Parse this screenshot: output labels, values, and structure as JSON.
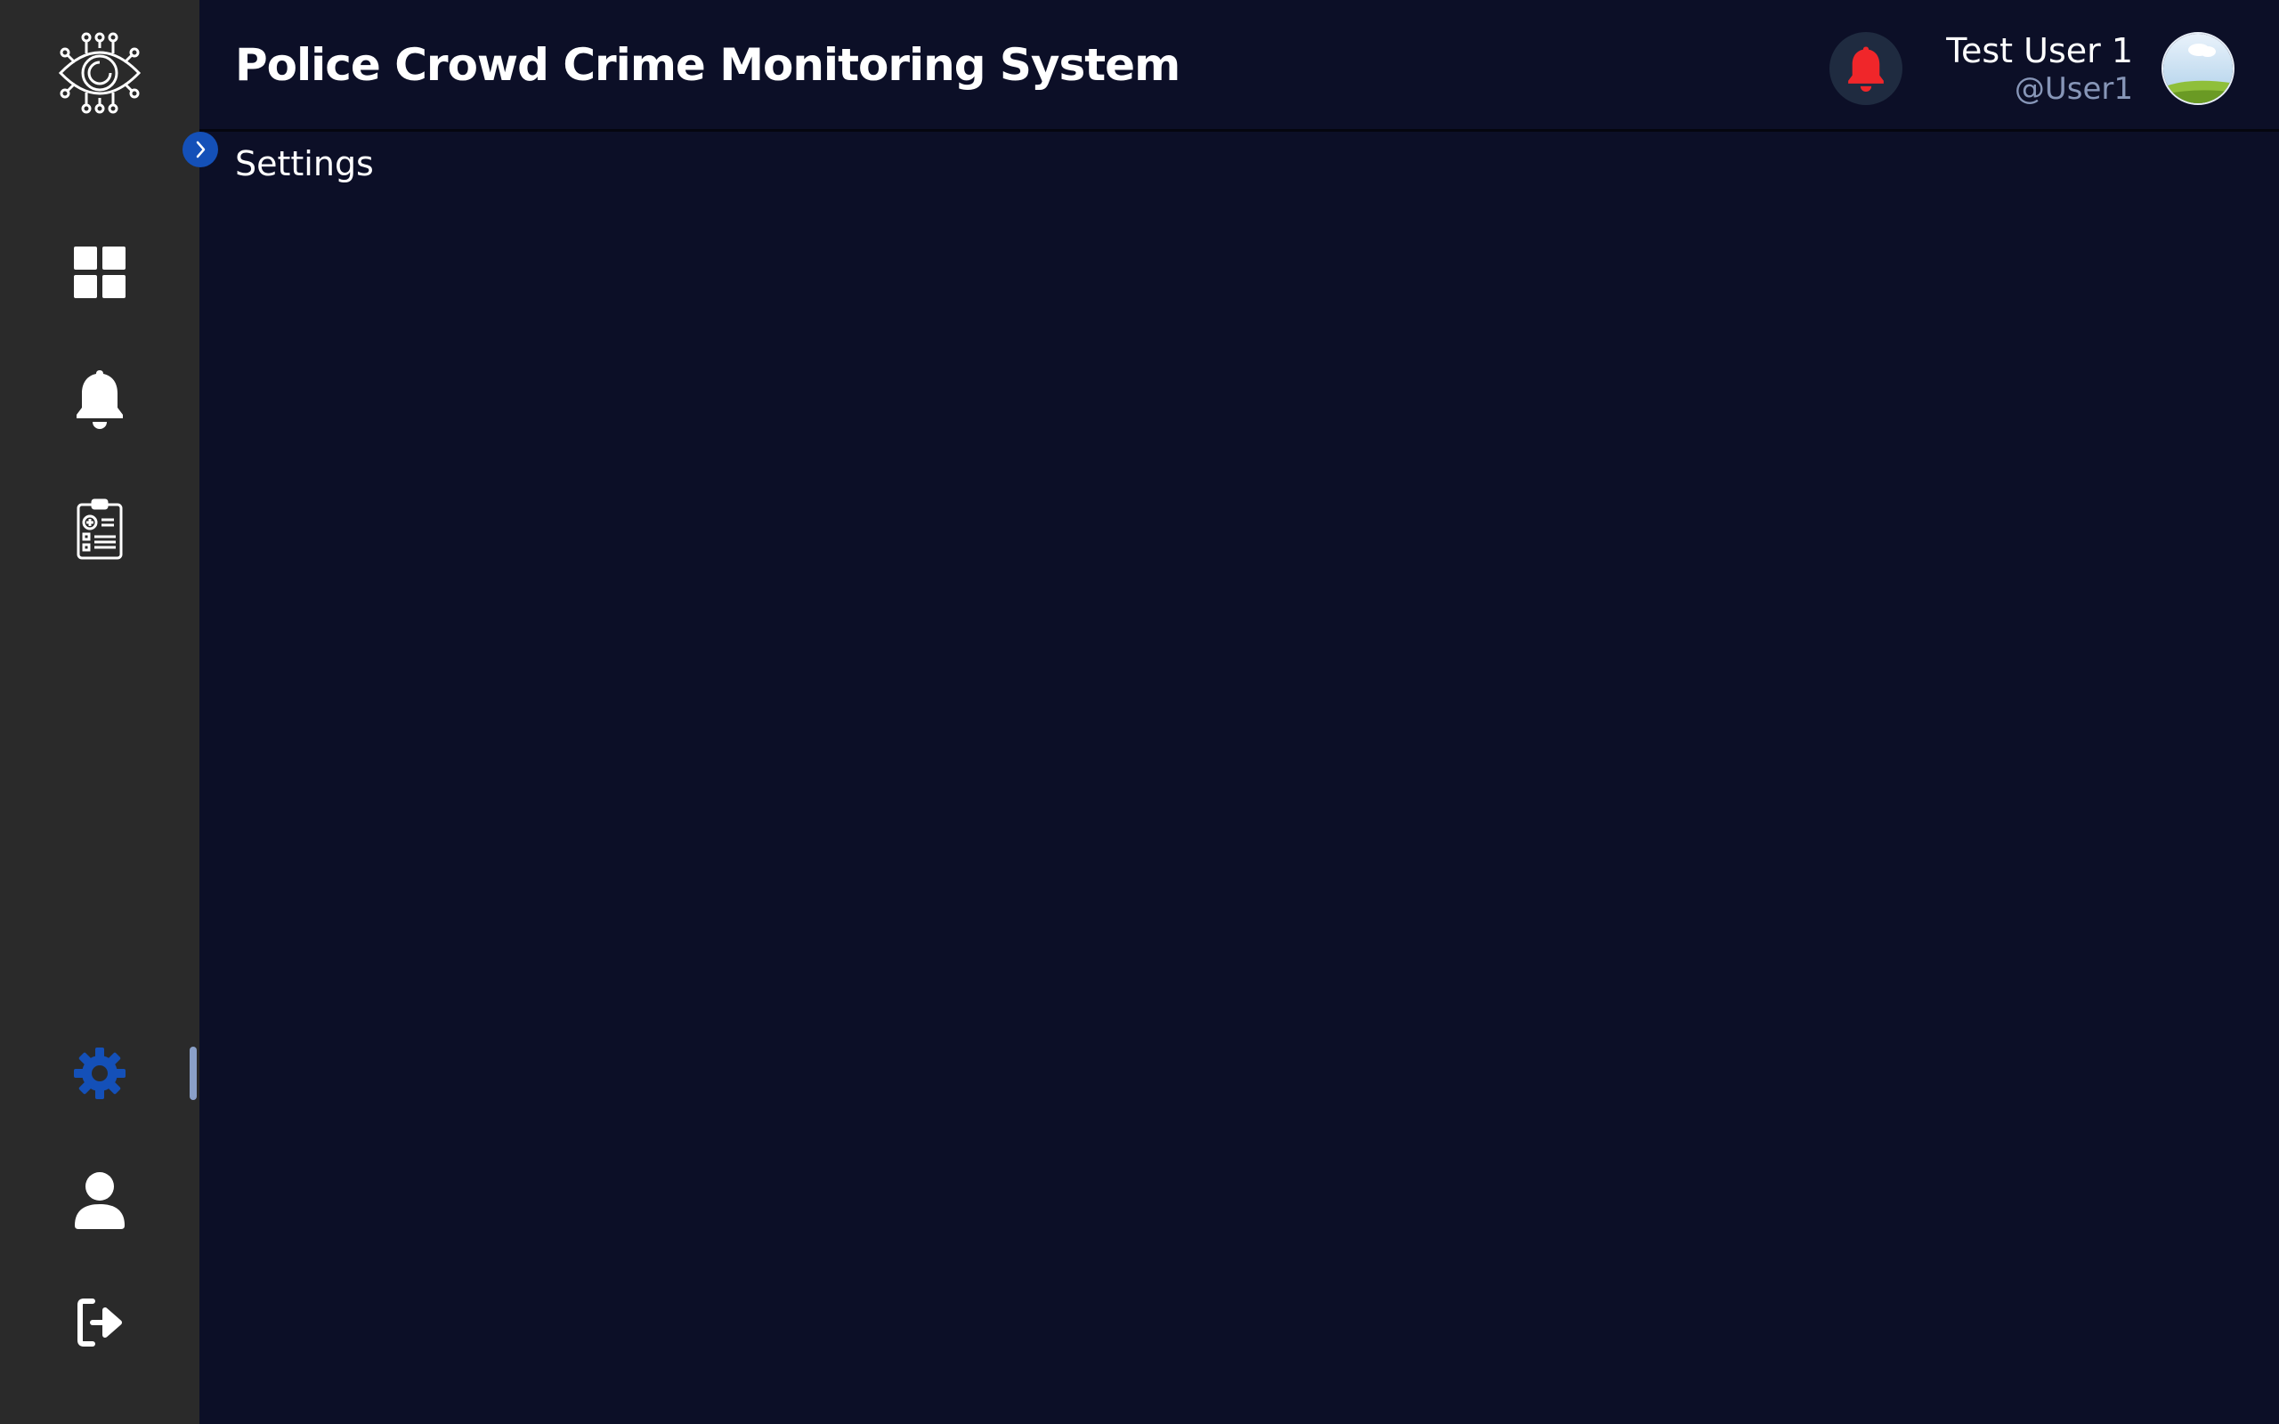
{
  "header": {
    "title": "Police Crowd Crime Monitoring System",
    "user": {
      "name": "Test User 1",
      "handle": "@User1"
    }
  },
  "page": {
    "title": "Settings"
  },
  "sidebar": {
    "items": [
      {
        "name": "dashboard",
        "icon": "grid-icon",
        "active": false
      },
      {
        "name": "notifications",
        "icon": "bell-icon",
        "active": false
      },
      {
        "name": "reports",
        "icon": "clipboard-icon",
        "active": false
      },
      {
        "name": "settings",
        "icon": "gear-icon",
        "active": true
      },
      {
        "name": "profile",
        "icon": "user-icon",
        "active": false
      },
      {
        "name": "logout",
        "icon": "logout-icon",
        "active": false
      }
    ]
  },
  "colors": {
    "background": "#0c0f27",
    "sidebar": "#2a2a2a",
    "accent": "#1450b8",
    "alert": "#f0262a",
    "muted_text": "#8796b8"
  }
}
